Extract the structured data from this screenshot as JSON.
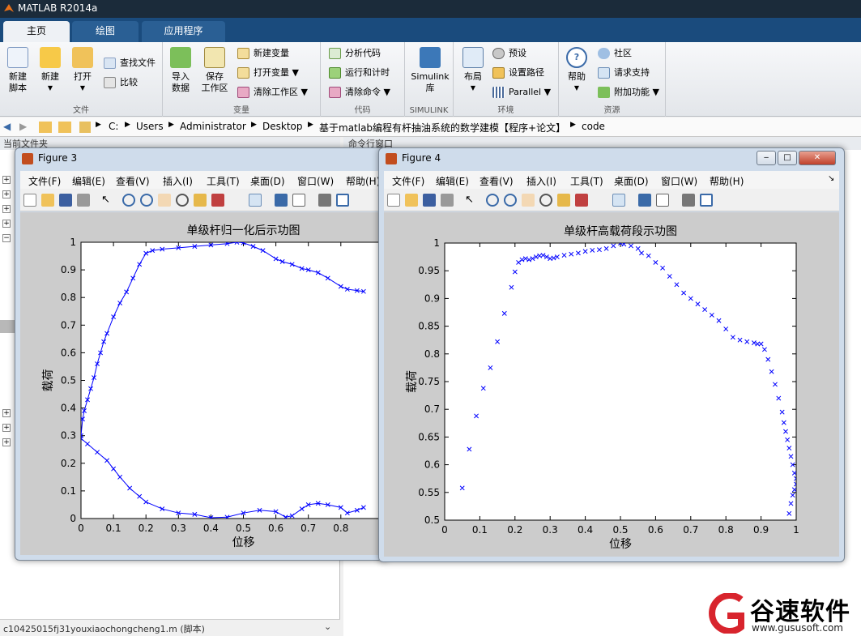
{
  "app": {
    "title": "MATLAB R2014a"
  },
  "ribbon_tabs": [
    "主页",
    "绘图",
    "应用程序"
  ],
  "ribbon": {
    "file": {
      "label": "文件",
      "new_script": "新建\n脚本",
      "new": "新建",
      "open": "打开",
      "find_files": "查找文件",
      "compare": "比较"
    },
    "variable": {
      "label": "变量",
      "import": "导入\n数据",
      "save_ws": "保存\n工作区",
      "new_var": "新建变量",
      "open_var": "打开变量",
      "clear_ws": "清除工作区"
    },
    "code": {
      "label": "代码",
      "analyze": "分析代码",
      "run_time": "运行和计时",
      "clear_cmd": "清除命令"
    },
    "simulink": {
      "label": "SIMULINK",
      "lib": "Simulink\n库"
    },
    "env": {
      "label": "环境",
      "layout": "布局",
      "prefs": "预设",
      "set_path": "设置路径",
      "parallel": "Parallel"
    },
    "resources": {
      "label": "资源",
      "help": "帮助",
      "community": "社区",
      "support": "请求支持",
      "addons": "附加功能"
    }
  },
  "address": [
    "C:",
    "Users",
    "Administrator",
    "Desktop",
    "基于matlab编程有杆抽油系统的数学建模【程序+论文】",
    "code"
  ],
  "left_panel": {
    "header": "当前文件夹",
    "footer": "c10425015fj31youxiaochongcheng1.m (脚本)"
  },
  "cmd_panel": {
    "header": "命令行窗口"
  },
  "menus": [
    "文件(F)",
    "编辑(E)",
    "查看(V)",
    "插入(I)",
    "工具(T)",
    "桌面(D)",
    "窗口(W)",
    "帮助(H)"
  ],
  "fig3": {
    "title": "Figure 3"
  },
  "fig4": {
    "title": "Figure 4"
  },
  "logo": {
    "brand": "谷速软件",
    "url": "www.gususoft.com"
  },
  "chart_data": [
    {
      "type": "line",
      "marker": "x",
      "color": "#0000ff",
      "title": "单级杆归一化后示功图",
      "xlabel": "位移",
      "ylabel": "载荷",
      "xlim": [
        0,
        1
      ],
      "ylim": [
        0,
        1
      ],
      "xticks": [
        0,
        0.1,
        0.2,
        0.3,
        0.4,
        0.5,
        0.6,
        0.7,
        0.8
      ],
      "yticks": [
        0,
        0.1,
        0.2,
        0.3,
        0.4,
        0.5,
        0.6,
        0.7,
        0.8,
        0.9,
        1
      ],
      "series": [
        {
          "x": [
            0,
            0.005,
            0.01,
            0.02,
            0.03,
            0.04,
            0.05,
            0.06,
            0.07,
            0.08,
            0.1,
            0.12,
            0.14,
            0.16,
            0.18,
            0.2,
            0.22,
            0.25,
            0.3,
            0.35,
            0.4,
            0.45,
            0.48,
            0.5,
            0.53,
            0.56,
            0.6,
            0.62,
            0.65,
            0.68,
            0.7,
            0.73,
            0.76,
            0.8,
            0.82,
            0.85,
            0.87
          ],
          "y": [
            0.3,
            0.36,
            0.39,
            0.43,
            0.47,
            0.51,
            0.56,
            0.6,
            0.64,
            0.67,
            0.73,
            0.78,
            0.82,
            0.87,
            0.92,
            0.96,
            0.97,
            0.975,
            0.98,
            0.985,
            0.99,
            0.995,
            1,
            0.998,
            0.985,
            0.97,
            0.94,
            0.93,
            0.92,
            0.905,
            0.9,
            0.89,
            0.87,
            0.84,
            0.83,
            0.825,
            0.822
          ]
        },
        {
          "x": [
            0,
            0.02,
            0.05,
            0.08,
            0.1,
            0.12,
            0.15,
            0.18,
            0.2,
            0.25,
            0.3,
            0.35,
            0.4,
            0.45,
            0.5,
            0.55,
            0.6,
            0.63,
            0.65,
            0.68,
            0.7,
            0.73,
            0.76,
            0.8,
            0.82,
            0.85,
            0.87
          ],
          "y": [
            0.29,
            0.27,
            0.24,
            0.21,
            0.18,
            0.15,
            0.11,
            0.08,
            0.06,
            0.035,
            0.02,
            0.015,
            0.003,
            0.005,
            0.02,
            0.03,
            0.025,
            0.005,
            0.01,
            0.035,
            0.05,
            0.055,
            0.05,
            0.04,
            0.02,
            0.03,
            0.04
          ]
        }
      ]
    },
    {
      "type": "scatter",
      "marker": "x",
      "color": "#0000ff",
      "title": "单级杆高载荷段示功图",
      "xlabel": "位移",
      "ylabel": "载荷",
      "xlim": [
        0,
        1
      ],
      "ylim": [
        0.5,
        1
      ],
      "xticks": [
        0,
        0.1,
        0.2,
        0.3,
        0.4,
        0.5,
        0.6,
        0.7,
        0.8,
        0.9,
        1
      ],
      "yticks": [
        0.5,
        0.55,
        0.6,
        0.65,
        0.7,
        0.75,
        0.8,
        0.85,
        0.9,
        0.95,
        1
      ],
      "series": [
        {
          "x": [
            0.05,
            0.07,
            0.09,
            0.11,
            0.13,
            0.15,
            0.17,
            0.19,
            0.2,
            0.21,
            0.22,
            0.23,
            0.24,
            0.25,
            0.26,
            0.27,
            0.28,
            0.29,
            0.3,
            0.31,
            0.32,
            0.34,
            0.36,
            0.38,
            0.4,
            0.42,
            0.44,
            0.46,
            0.48,
            0.5,
            0.51,
            0.53,
            0.55,
            0.56,
            0.58,
            0.6,
            0.62,
            0.64,
            0.66,
            0.68,
            0.7,
            0.72,
            0.74,
            0.76,
            0.78,
            0.8,
            0.82,
            0.84,
            0.86,
            0.88,
            0.89,
            0.9,
            0.91,
            0.92,
            0.93,
            0.94,
            0.95,
            0.96,
            0.965,
            0.97,
            0.975,
            0.98,
            0.985,
            0.99,
            0.995,
            1,
            1,
            0.995,
            0.99,
            0.985,
            0.98
          ],
          "y": [
            0.558,
            0.628,
            0.688,
            0.738,
            0.775,
            0.822,
            0.873,
            0.92,
            0.948,
            0.965,
            0.97,
            0.972,
            0.97,
            0.972,
            0.975,
            0.977,
            0.978,
            0.975,
            0.972,
            0.973,
            0.975,
            0.978,
            0.98,
            0.982,
            0.985,
            0.987,
            0.988,
            0.99,
            0.995,
            1,
            0.998,
            0.995,
            0.99,
            0.982,
            0.977,
            0.965,
            0.955,
            0.94,
            0.925,
            0.91,
            0.9,
            0.89,
            0.88,
            0.87,
            0.86,
            0.845,
            0.83,
            0.825,
            0.822,
            0.82,
            0.818,
            0.818,
            0.808,
            0.79,
            0.768,
            0.745,
            0.72,
            0.695,
            0.676,
            0.66,
            0.645,
            0.63,
            0.615,
            0.6,
            0.585,
            0.575,
            0.565,
            0.555,
            0.545,
            0.53,
            0.512
          ]
        }
      ]
    }
  ]
}
